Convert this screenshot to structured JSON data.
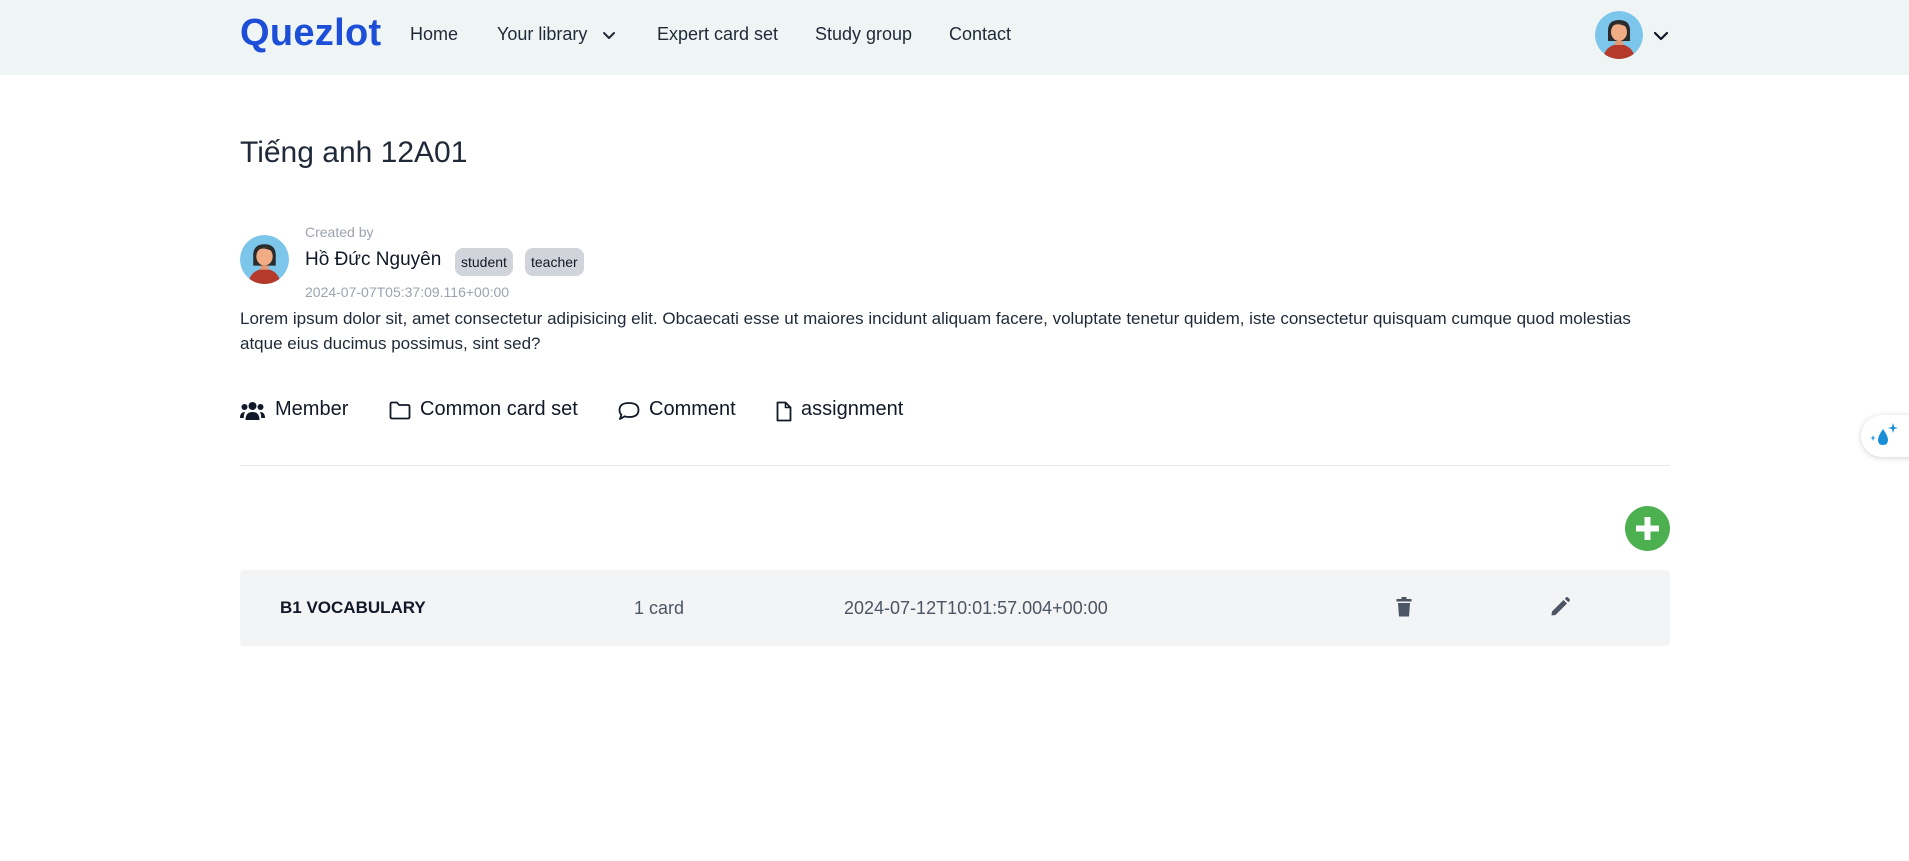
{
  "nav": {
    "brand": "Quezlot",
    "links": [
      "Home",
      "Your library",
      "Expert card set",
      "Study group",
      "Contact"
    ]
  },
  "group": {
    "title": "Tiếng anh 12A01",
    "created_by_label": "Created by",
    "creator_name": "Hồ Đức Nguyên",
    "roles": [
      "student",
      "teacher"
    ],
    "created_at": "2024-07-07T05:37:09.116+00:00",
    "description": "Lorem ipsum dolor sit, amet consectetur adipisicing elit. Obcaecati esse ut maiores incidunt aliquam facere, voluptate tenetur quidem, iste consectetur quisquam cumque quod molestias atque eius ducimus possimus, sint sed?"
  },
  "tabs": [
    {
      "label": "Member",
      "icon": "users-icon"
    },
    {
      "label": "Common card set",
      "icon": "folder-icon"
    },
    {
      "label": "Comment",
      "icon": "comment-icon"
    },
    {
      "label": "assignment",
      "icon": "file-icon"
    }
  ],
  "card_sets": [
    {
      "name": "B1 VOCABULARY",
      "count": "1 card",
      "date": "2024-07-12T10:01:57.004+00:00"
    }
  ],
  "colors": {
    "brand": "#1d4ed8",
    "add_button": "#4caf50",
    "navbar_bg": "#eff4f4"
  }
}
